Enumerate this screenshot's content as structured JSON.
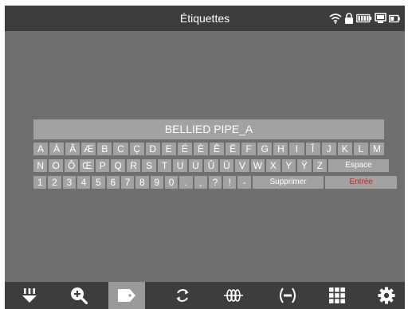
{
  "header": {
    "title": "Étiquettes"
  },
  "status_icons": [
    "wifi-icon",
    "lock-icon",
    "battery-icon",
    "monitor-icon",
    "small-battery-icon"
  ],
  "keyboard": {
    "input_text": "BELLIED PIPE_A",
    "rows": [
      [
        "A",
        "À",
        "Â",
        "Æ",
        "B",
        "C",
        "Ç",
        "D",
        "E",
        "É",
        "È",
        "Ê",
        "Ë",
        "F",
        "G",
        "H",
        "I",
        "Î",
        "J",
        "K",
        "L",
        "M"
      ],
      [
        "N",
        "O",
        "Ô",
        "Œ",
        "P",
        "Q",
        "R",
        "S",
        "T",
        "U",
        "Ù",
        "Û",
        "Ü",
        "V",
        "W",
        "X",
        "Y",
        "Ÿ",
        "Z",
        "Espace"
      ],
      [
        "1",
        "2",
        "3",
        "4",
        "5",
        "6",
        "7",
        "8",
        "9",
        "0",
        ".",
        ",",
        "?",
        "!",
        "-",
        "Supprimer",
        "Entrée"
      ]
    ]
  },
  "bottom_bar": {
    "active_tab": "tag-icon",
    "items": [
      "light-icon",
      "zoom-in-icon",
      "tag-icon",
      "rotate-icon",
      "coil-icon",
      "signal-icon",
      "grid-icon",
      "settings-icon"
    ]
  },
  "colors": {
    "bar": "#3d3d3d",
    "content": "#6f6f6f",
    "key": "#a2a2a2",
    "key_text": "#ffffff",
    "enter_text": "#c0261f",
    "active_tab": "#9a9a9a"
  }
}
